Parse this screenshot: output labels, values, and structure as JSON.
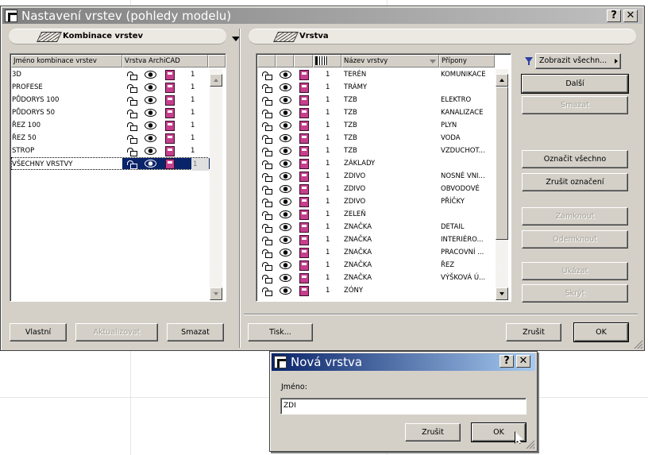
{
  "main_dialog": {
    "title": "Nastavení vrstev (pohledy modelu)",
    "help_button": "?",
    "close_button": "✕",
    "combinations": {
      "header": "Kombinace vrstev",
      "col_name": "Jméno kombinace vrstev",
      "col_layer": "Vrstva ArchiCAD",
      "rows": [
        {
          "name": "3D",
          "num": "1"
        },
        {
          "name": "PROFESE",
          "num": "1"
        },
        {
          "name": "PŮDORYS 100",
          "num": "1"
        },
        {
          "name": "PŮDORYS 50",
          "num": "1"
        },
        {
          "name": "ŘEZ 100",
          "num": "1"
        },
        {
          "name": "ŘEZ 50",
          "num": "1"
        },
        {
          "name": "STROP",
          "num": "1"
        },
        {
          "name": "VŠECHNY VRSTVY",
          "num": "1"
        }
      ],
      "buttons": {
        "custom": "Vlastní",
        "update": "Aktualizovat",
        "delete": "Smazat"
      }
    },
    "layers": {
      "header": "Vrstva",
      "col_name": "Název vrstvy",
      "col_suffix": "Přípony",
      "filter_button": "Zobrazit všechn...",
      "rows": [
        {
          "num": "1",
          "name": "TERÉN",
          "suffix": "KOMUNIKACE"
        },
        {
          "num": "1",
          "name": "TRÁMY",
          "suffix": ""
        },
        {
          "num": "1",
          "name": "TZB",
          "suffix": "ELEKTRO"
        },
        {
          "num": "1",
          "name": "TZB",
          "suffix": "KANALIZACE"
        },
        {
          "num": "1",
          "name": "TZB",
          "suffix": "PLYN"
        },
        {
          "num": "1",
          "name": "TZB",
          "suffix": "VODA"
        },
        {
          "num": "1",
          "name": "TZB",
          "suffix": "VZDUCHOT..."
        },
        {
          "num": "1",
          "name": "ZÁKLADY",
          "suffix": ""
        },
        {
          "num": "1",
          "name": "ZDIVO",
          "suffix": "NOSNÉ VNI..."
        },
        {
          "num": "1",
          "name": "ZDIVO",
          "suffix": "OBVODOVÉ"
        },
        {
          "num": "1",
          "name": "ZDIVO",
          "suffix": "PŘÍČKY"
        },
        {
          "num": "1",
          "name": "ZELEŇ",
          "suffix": ""
        },
        {
          "num": "1",
          "name": "ZNAČKA",
          "suffix": "DETAIL"
        },
        {
          "num": "1",
          "name": "ZNAČKA",
          "suffix": "INTERIÉRO..."
        },
        {
          "num": "1",
          "name": "ZNAČKA",
          "suffix": "PRACOVNÍ ..."
        },
        {
          "num": "1",
          "name": "ZNAČKA",
          "suffix": "ŘEZ"
        },
        {
          "num": "1",
          "name": "ZNAČKA",
          "suffix": "VÝŠKOVÁ Ú..."
        },
        {
          "num": "1",
          "name": "ZÓNY",
          "suffix": ""
        }
      ],
      "buttons": {
        "next": "Další",
        "delete": "Smazat",
        "select_all": "Označit všechno",
        "deselect": "Zrušit označení",
        "lock": "Zamknout",
        "unlock": "Odemknout",
        "show": "Ukázat",
        "hide": "Skrýt"
      }
    },
    "bottom": {
      "print": "Tisk...",
      "cancel": "Zrušit",
      "ok": "OK"
    }
  },
  "new_layer_dialog": {
    "title": "Nová vrstva",
    "help_button": "?",
    "close_button": "✕",
    "name_label": "Jméno:",
    "name_value": "ZDI",
    "cancel": "Zrušit",
    "ok": "OK"
  }
}
